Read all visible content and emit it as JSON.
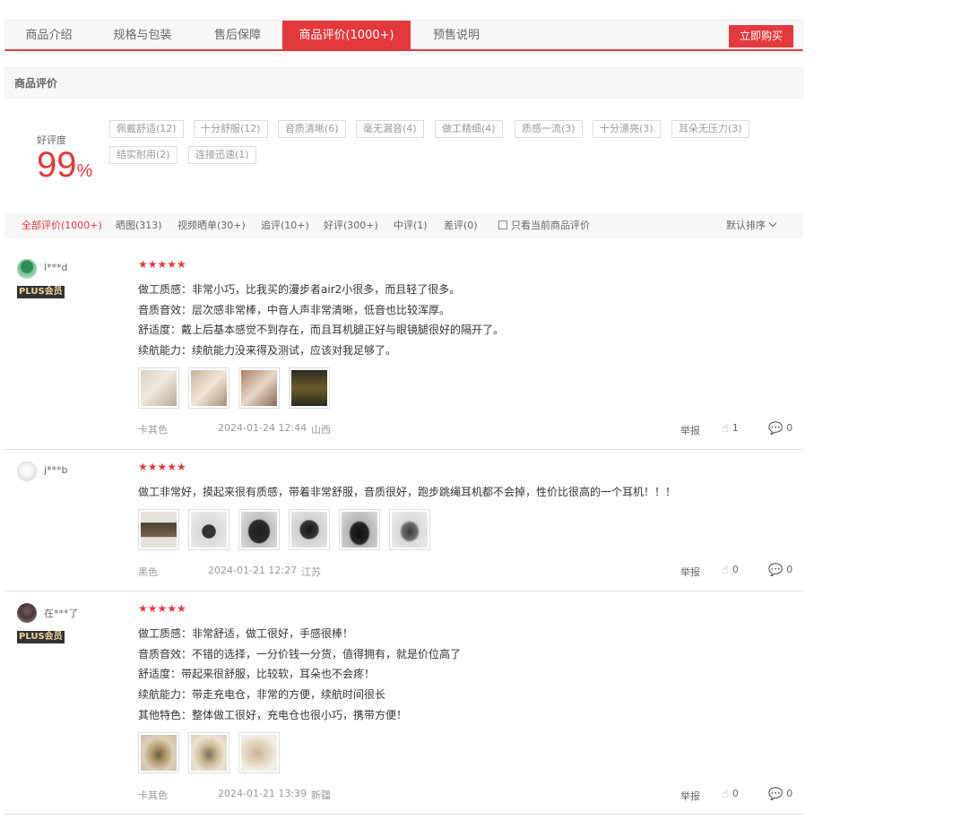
{
  "tabs": [
    "商品介绍",
    "规格与包装",
    "售后保障",
    "商品评价(1000+)",
    "预售说明"
  ],
  "buy_button": "立即购买",
  "section_title": "商品评价",
  "rate": {
    "label": "好评度",
    "value": "99",
    "unit": "%"
  },
  "tags": [
    "佩戴舒适(12)",
    "十分舒服(12)",
    "音质清晰(6)",
    "毫无漏音(4)",
    "做工精细(4)",
    "质感一流(3)",
    "十分漂亮(3)",
    "耳朵无压力(3)",
    "结实耐用(2)",
    "连接迅速(1)"
  ],
  "filters": [
    "全部评价(1000+)",
    "晒图(313)",
    "视频晒单(30+)",
    "追评(10+)",
    "好评(300+)",
    "中评(1)",
    "差评(0)"
  ],
  "only_current_label": "只看当前商品评价",
  "sort_label": "默认排序",
  "report_label": "举报",
  "colors": {
    "accent": "#e4393c"
  },
  "reviews": [
    {
      "user": "l***d",
      "plus": "PLUS会员",
      "stars": "★★★★★",
      "lines": [
        "做工质感：非常小巧，比我买的漫步者air2小很多，而且轻了很多。",
        "音质音效：层次感非常棒，中音人声非常清晰，低音也比较浑厚。",
        "舒适度：戴上后基本感觉不到存在，而且耳机腿正好与眼镜腿很好的隔开了。",
        "续航能力：续航能力没来得及测试，应该对我足够了。"
      ],
      "color": "卡其色",
      "date": "2024-01-24 12:44",
      "region": "山西",
      "likes": "1",
      "comments": "0"
    },
    {
      "user": "j***b",
      "plus": "",
      "stars": "★★★★★",
      "lines": [
        "做工非常好，摸起来很有质感，带着非常舒服，音质很好，跑步跳绳耳机都不会掉，性价比很高的一个耳机！！！"
      ],
      "color": "黑色",
      "date": "2024-01-21 12:27",
      "region": "江苏",
      "likes": "0",
      "comments": "0"
    },
    {
      "user": "在***了",
      "plus": "PLUS会员",
      "stars": "★★★★★",
      "lines": [
        "做工质感：非常舒适，做工很好，手感很棒！",
        "音质音效：不错的选择，一分价钱一分货，值得拥有，就是价位高了",
        "舒适度：带起来很舒服，比较软，耳朵也不会疼！",
        "续航能力：带走充电仓，非常的方便，续航时间很长",
        "其他特色：整体做工很好，充电仓也很小巧，携带方便！"
      ],
      "color": "卡其色",
      "date": "2024-01-21 13:39",
      "region": "新疆",
      "likes": "0",
      "comments": "0"
    }
  ]
}
